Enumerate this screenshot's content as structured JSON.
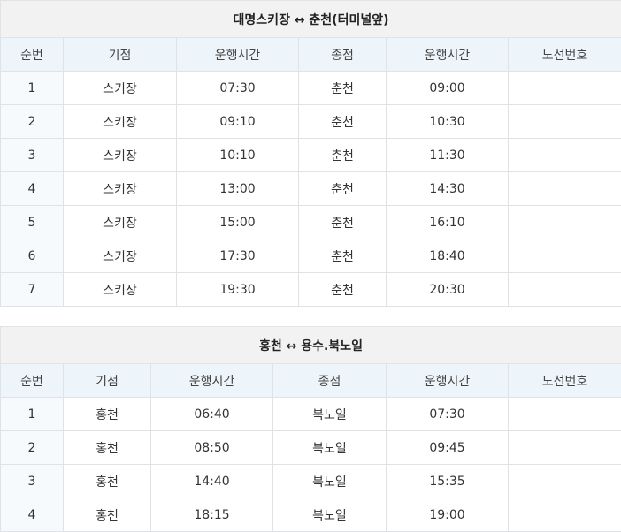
{
  "tables": [
    {
      "title": "대명스키장 ↔ 춘천(터미널앞)",
      "headers": [
        "순번",
        "기점",
        "운행시간",
        "종점",
        "운행시간",
        "노선번호"
      ],
      "rows": [
        [
          "1",
          "스키장",
          "07:30",
          "춘천",
          "09:00",
          ""
        ],
        [
          "2",
          "스키장",
          "09:10",
          "춘천",
          "10:30",
          ""
        ],
        [
          "3",
          "스키장",
          "10:10",
          "춘천",
          "11:30",
          ""
        ],
        [
          "4",
          "스키장",
          "13:00",
          "춘천",
          "14:30",
          ""
        ],
        [
          "5",
          "스키장",
          "15:00",
          "춘천",
          "16:10",
          ""
        ],
        [
          "6",
          "스키장",
          "17:30",
          "춘천",
          "18:40",
          ""
        ],
        [
          "7",
          "스키장",
          "19:30",
          "춘천",
          "20:30",
          ""
        ]
      ]
    },
    {
      "title": "홍천 ↔ 용수.북노일",
      "headers": [
        "순번",
        "기점",
        "운행시간",
        "종점",
        "운행시간",
        "노선번호"
      ],
      "rows": [
        [
          "1",
          "홍천",
          "06:40",
          "북노일",
          "07:30",
          ""
        ],
        [
          "2",
          "홍천",
          "08:50",
          "북노일",
          "09:45",
          ""
        ],
        [
          "3",
          "홍천",
          "14:40",
          "북노일",
          "15:35",
          ""
        ],
        [
          "4",
          "홍천",
          "18:15",
          "북노일",
          "19:00",
          ""
        ]
      ]
    }
  ]
}
